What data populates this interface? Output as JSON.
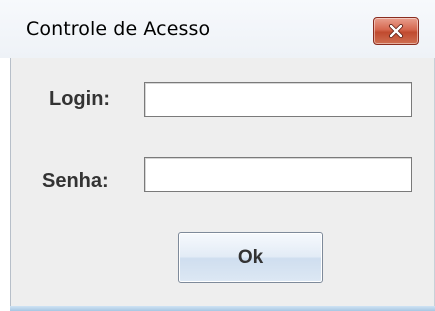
{
  "window": {
    "title": "Controle de Acesso",
    "close_icon": "close-icon"
  },
  "form": {
    "login_label": "Login:",
    "login_value": "",
    "senha_label": "Senha:",
    "senha_value": "",
    "ok_label": "Ok"
  },
  "colors": {
    "content_background": "#eeeeee",
    "close_button": "#c7503a",
    "label_text": "#333333"
  }
}
